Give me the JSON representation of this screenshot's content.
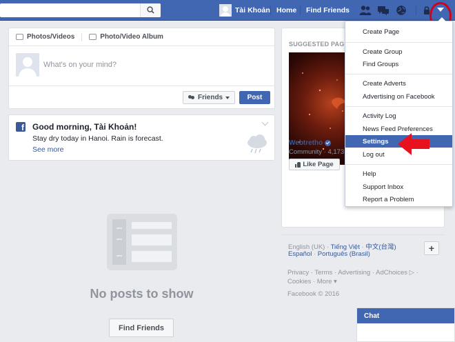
{
  "topbar": {
    "user_name": "Tài Khoản",
    "nav_home": "Home",
    "nav_find_friends": "Find Friends"
  },
  "composer": {
    "tab_photos": "Photos/Videos",
    "tab_album": "Photo/Video Album",
    "placeholder": "What's on your mind?",
    "audience": "Friends",
    "post_label": "Post"
  },
  "greeting": {
    "logo": "f",
    "title": "Good morning, Tài Khoản!",
    "body": "Stay dry today in Hanoi. Rain is forecast.",
    "link": "See more"
  },
  "feed": {
    "empty_text": "No posts to show",
    "find_friends_label": "Find Friends"
  },
  "suggested": {
    "header": "SUGGESTED PAGES",
    "page_name": "Webtretho",
    "page_meta": "Community · 4,173,",
    "like_label": "Like Page"
  },
  "languages": {
    "current": "English (UK)",
    "options": [
      "Tiếng Việt",
      "中文(台灣)",
      "Español",
      "Português (Brasil)"
    ]
  },
  "footer": {
    "links_line1": "Privacy · Terms · Advertising · AdChoices ▷ ·",
    "links_line2": "Cookies · More ▾",
    "copyright": "Facebook © 2016"
  },
  "menu": {
    "items": [
      "Create Page",
      "Create Group",
      "Find Groups",
      "Create Adverts",
      "Advertising on Facebook",
      "Activity Log",
      "News Feed Preferences",
      "Settings",
      "Log out",
      "Help",
      "Support Inbox",
      "Report a Problem"
    ],
    "active_item": "Settings"
  },
  "chat": {
    "label": "Chat"
  },
  "colors": {
    "brand": "#4267b2",
    "highlight": "#d0021b"
  }
}
